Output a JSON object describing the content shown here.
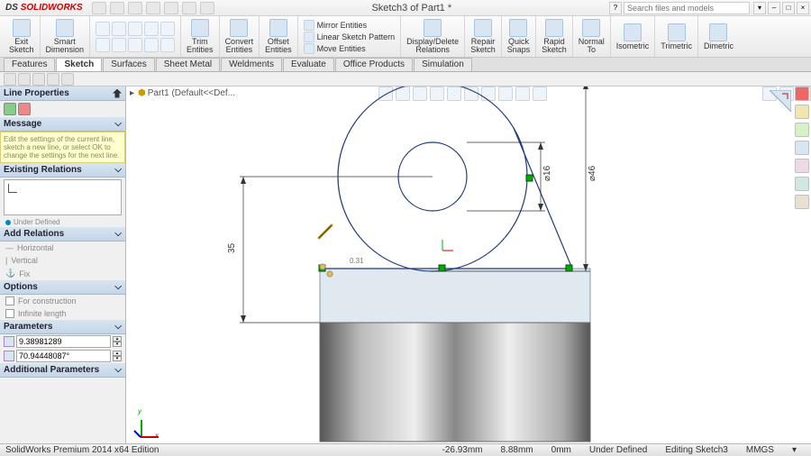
{
  "app": {
    "brand_ds": "DS",
    "brand_name": "SOLIDWORKS",
    "doc_title": "Sketch3 of Part1 *",
    "search_placeholder": "Search files and models"
  },
  "ribbon": {
    "exit_sketch": "Exit\nSketch",
    "smart_dim": "Smart\nDimension",
    "trim": "Trim\nEntities",
    "convert": "Convert\nEntities",
    "offset": "Offset\nEntities",
    "mirror": "Mirror Entities",
    "pattern": "Linear Sketch Pattern",
    "move": "Move Entities",
    "disp_rel": "Display/Delete\nRelations",
    "repair": "Repair\nSketch",
    "quick": "Quick\nSnaps",
    "rapid": "Rapid\nSketch",
    "normal": "Normal\nTo",
    "iso": "Isometric",
    "tri": "Trimetric",
    "dim": "Dimetric"
  },
  "tabs": [
    "Features",
    "Sketch",
    "Surfaces",
    "Sheet Metal",
    "Weldments",
    "Evaluate",
    "Office Products",
    "Simulation"
  ],
  "tree": {
    "part": "Part1 (Default<<Def..."
  },
  "panel": {
    "title": "Line Properties",
    "msg_head": "Message",
    "msg_body": "Edit the settings of the current line, sketch a new line, or select OK to change the settings for the next line.",
    "existing": "Existing Relations",
    "under_defined": "Under Defined",
    "add": "Add Relations",
    "horiz": "Horizontal",
    "vert": "Vertical",
    "fix": "Fix",
    "options": "Options",
    "forcon": "For construction",
    "inflen": "Infinite length",
    "params": "Parameters",
    "p_len": "9.38981289",
    "p_ang": "70.94448087°",
    "addl": "Additional Parameters"
  },
  "sketch": {
    "dim35": "35",
    "dim16": "⌀16",
    "dim46": "⌀46",
    "notelen": "0.31"
  },
  "status": {
    "edition": "SolidWorks Premium 2014 x64 Edition",
    "x": "-26.93mm",
    "y": "8.88mm",
    "z": "0mm",
    "state": "Under Defined",
    "editing": "Editing Sketch3",
    "units": "MMGS"
  }
}
